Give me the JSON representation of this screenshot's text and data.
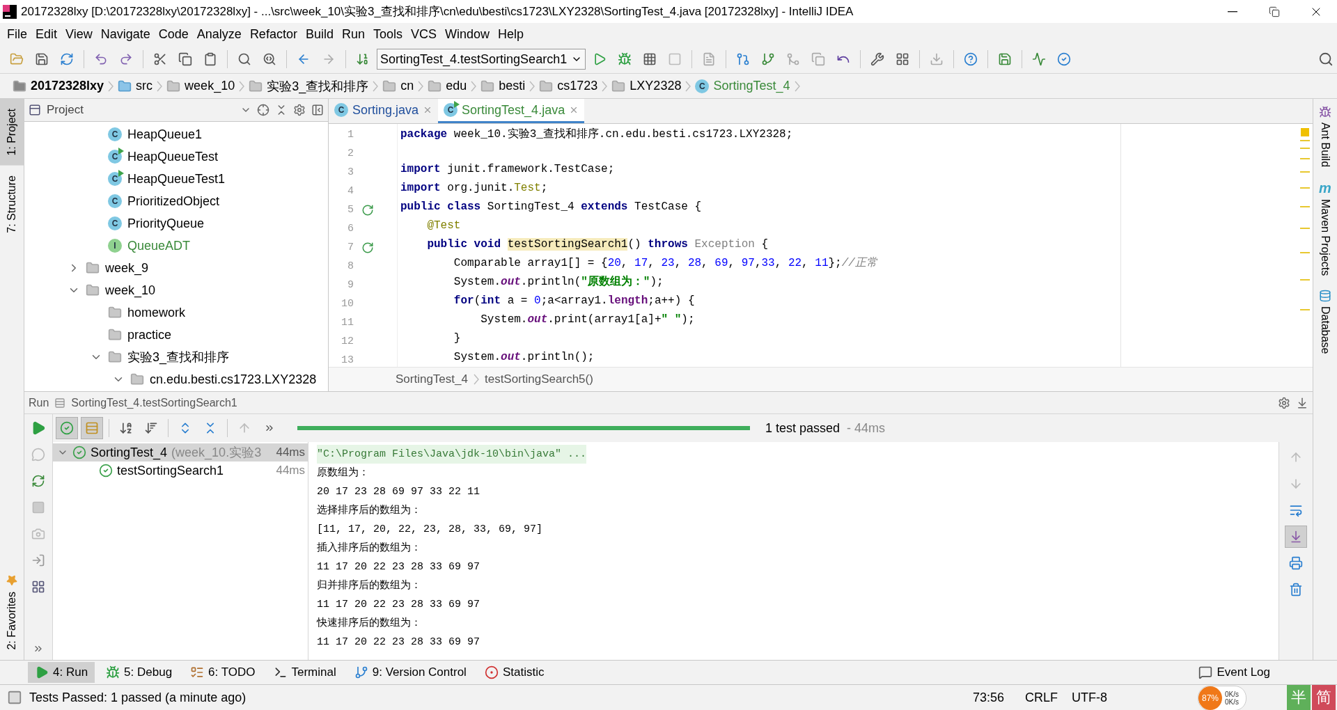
{
  "window": {
    "title": "20172328lxy [D:\\20172328lxy\\20172328lxy] - ...\\src\\week_10\\实验3_查找和排序\\cn\\edu\\besti\\cs1723\\LXY2328\\SortingTest_4.java [20172328lxy] - IntelliJ IDEA"
  },
  "menu": [
    "File",
    "Edit",
    "View",
    "Navigate",
    "Code",
    "Analyze",
    "Refactor",
    "Build",
    "Run",
    "Tools",
    "VCS",
    "Window",
    "Help"
  ],
  "toolbar": {
    "run_configuration": "SortingTest_4.testSortingSearch1"
  },
  "navigation": [
    {
      "label": "20172328lxy",
      "kind": "module"
    },
    {
      "label": "src",
      "kind": "source"
    },
    {
      "label": "week_10",
      "kind": "folder"
    },
    {
      "label": "实验3_查找和排序",
      "kind": "folder"
    },
    {
      "label": "cn",
      "kind": "folder"
    },
    {
      "label": "edu",
      "kind": "folder"
    },
    {
      "label": "besti",
      "kind": "folder"
    },
    {
      "label": "cs1723",
      "kind": "folder"
    },
    {
      "label": "LXY2328",
      "kind": "folder"
    },
    {
      "label": "SortingTest_4",
      "kind": "class",
      "badge": "C",
      "color": "#3a8a3a"
    }
  ],
  "tool_strip_left": [
    {
      "label": "1: Project",
      "selected": true
    },
    {
      "label": "7: Structure",
      "selected": false
    }
  ],
  "favorites": {
    "label": "2: Favorites"
  },
  "tool_strip_right": [
    {
      "label": "Ant Build",
      "kind": "ant"
    },
    {
      "label": "Maven Projects",
      "kind": "maven",
      "glyph": "m"
    },
    {
      "label": "Database",
      "kind": "database"
    }
  ],
  "project": {
    "title": "Project",
    "tree_tail": [
      {
        "label": "HeapQueue1",
        "kind": "class",
        "badge": "C",
        "color": "#000000"
      },
      {
        "label": "HeapQueueTest",
        "kind": "test",
        "badge": "C",
        "color": "#000000"
      },
      {
        "label": "HeapQueueTest1",
        "kind": "test",
        "badge": "C",
        "color": "#000000"
      },
      {
        "label": "PrioritizedObject",
        "kind": "class",
        "badge": "C",
        "color": "#000000"
      },
      {
        "label": "PriorityQueue",
        "kind": "class",
        "badge": "C",
        "color": "#000000"
      },
      {
        "label": "QueueADT",
        "kind": "interface",
        "badge": "I",
        "color": "#3a8a3a"
      }
    ],
    "tree": [
      {
        "label": "week_9",
        "expanded": false
      },
      {
        "label": "week_10",
        "expanded": true,
        "children": [
          {
            "label": "homework"
          },
          {
            "label": "practice"
          },
          {
            "label": "实验3_查找和排序",
            "expanded": true,
            "children": [
              {
                "label": "cn.edu.besti.cs1723.LXY2328",
                "expanded": true
              }
            ]
          }
        ]
      }
    ]
  },
  "editor": {
    "tabs": [
      {
        "label": "Sorting.java",
        "badge": "C",
        "kind": "class",
        "selected": false,
        "color": "#1f4e9c"
      },
      {
        "label": "SortingTest_4.java",
        "badge": "C",
        "kind": "test",
        "selected": true,
        "color": "#3a8a3a"
      }
    ],
    "lines": [
      {
        "number": "1",
        "run": false,
        "tokens": [
          {
            "text": "package",
            "kind": "keyword"
          },
          {
            "text": " week_10.实验3_查找和排序.cn.edu.besti.cs1723.LXY2328;",
            "kind": "plain"
          }
        ]
      },
      {
        "number": "2",
        "run": false
      },
      {
        "number": "3",
        "run": false,
        "tokens": [
          {
            "text": "import",
            "kind": "keyword"
          },
          {
            "text": " junit.framework.TestCase;",
            "kind": "plain"
          }
        ]
      },
      {
        "number": "4",
        "run": false,
        "tokens": [
          {
            "text": "import",
            "kind": "keyword"
          },
          {
            "text": " org.junit.",
            "kind": "plain"
          },
          {
            "text": "Test",
            "kind": "annotation"
          },
          {
            "text": ";",
            "kind": "plain"
          }
        ]
      },
      {
        "number": "5",
        "run": true,
        "tokens": [
          {
            "text": "public class",
            "kind": "keyword"
          },
          {
            "text": " SortingTest_4 ",
            "kind": "plain"
          },
          {
            "text": "extends",
            "kind": "keyword"
          },
          {
            "text": " TestCase {",
            "kind": "plain"
          }
        ]
      },
      {
        "number": "6",
        "run": false,
        "tokens": [
          {
            "text": "    @Test",
            "kind": "annotation"
          }
        ]
      },
      {
        "number": "7",
        "run": true,
        "tokens": [
          {
            "text": "    public void ",
            "kind": "keyword"
          },
          {
            "text": "testSortingSearch1",
            "kind": "highlight"
          },
          {
            "text": "() ",
            "kind": "plain"
          },
          {
            "text": "throws ",
            "kind": "keyword"
          },
          {
            "text": "Exception",
            "kind": "unresolved"
          },
          {
            "text": " {",
            "kind": "plain"
          }
        ]
      },
      {
        "number": "8",
        "run": false,
        "tokens": [
          {
            "text": "        Comparable array1[] = {",
            "kind": "plain"
          },
          {
            "text": "20",
            "kind": "number"
          },
          {
            "text": ", ",
            "kind": "plain"
          },
          {
            "text": "17",
            "kind": "number"
          },
          {
            "text": ", ",
            "kind": "plain"
          },
          {
            "text": "23",
            "kind": "number"
          },
          {
            "text": ", ",
            "kind": "plain"
          },
          {
            "text": "28",
            "kind": "number"
          },
          {
            "text": ", ",
            "kind": "plain"
          },
          {
            "text": "69",
            "kind": "number"
          },
          {
            "text": ", ",
            "kind": "plain"
          },
          {
            "text": "97",
            "kind": "number"
          },
          {
            "text": ",",
            "kind": "plain"
          },
          {
            "text": "33",
            "kind": "number"
          },
          {
            "text": ", ",
            "kind": "plain"
          },
          {
            "text": "22",
            "kind": "number"
          },
          {
            "text": ", ",
            "kind": "plain"
          },
          {
            "text": "11",
            "kind": "number"
          },
          {
            "text": "};",
            "kind": "plain"
          },
          {
            "text": "//正常",
            "kind": "comment"
          }
        ]
      },
      {
        "number": "9",
        "run": false,
        "tokens": [
          {
            "text": "        System.",
            "kind": "plain"
          },
          {
            "text": "out",
            "kind": "field"
          },
          {
            "text": ".println(",
            "kind": "plain"
          },
          {
            "text": "\"原数组为：\"",
            "kind": "string"
          },
          {
            "text": ");",
            "kind": "plain"
          }
        ]
      },
      {
        "number": "10",
        "run": false,
        "tokens": [
          {
            "text": "        for",
            "kind": "keyword"
          },
          {
            "text": "(",
            "kind": "plain"
          },
          {
            "text": "int",
            "kind": "keyword"
          },
          {
            "text": " a = ",
            "kind": "plain"
          },
          {
            "text": "0",
            "kind": "number"
          },
          {
            "text": ";a<array1.",
            "kind": "plain"
          },
          {
            "text": "length",
            "kind": "member"
          },
          {
            "text": ";a++) {",
            "kind": "plain"
          }
        ]
      },
      {
        "number": "11",
        "run": false,
        "tokens": [
          {
            "text": "            System.",
            "kind": "plain"
          },
          {
            "text": "out",
            "kind": "field"
          },
          {
            "text": ".print(array1[a]+",
            "kind": "plain"
          },
          {
            "text": "\" \"",
            "kind": "string"
          },
          {
            "text": ");",
            "kind": "plain"
          }
        ]
      },
      {
        "number": "12",
        "run": false,
        "tokens": [
          {
            "text": "        }",
            "kind": "plain"
          }
        ]
      },
      {
        "number": "13",
        "run": false,
        "tokens": [
          {
            "text": "        System.",
            "kind": "plain"
          },
          {
            "text": "out",
            "kind": "field"
          },
          {
            "text": ".println();",
            "kind": "plain"
          }
        ]
      }
    ],
    "breadcrumb": [
      "SortingTest_4",
      "testSortingSearch5()"
    ]
  },
  "run": {
    "title": "Run",
    "config": "SortingTest_4.testSortingSearch1",
    "progress": {
      "level": 1
    },
    "summary": "1 test passed",
    "duration": "- 44ms",
    "tests": [
      {
        "name": "SortingTest_4",
        "detail": "(week_10.实验3",
        "time": "44ms",
        "passed": true,
        "selected": true,
        "expanded": true,
        "children": [
          {
            "name": "testSortingSearch1",
            "time": "44ms",
            "passed": true,
            "selected": false
          }
        ]
      }
    ],
    "console": [
      {
        "text": "\"C:\\Program Files\\Java\\jdk-10\\bin\\java\" ...",
        "kind": "command"
      },
      {
        "text": "原数组为：",
        "kind": "output"
      },
      {
        "text": "20 17 23 28 69 97 33 22 11",
        "kind": "output"
      },
      {
        "text": "选择排序后的数组为：",
        "kind": "output"
      },
      {
        "text": "[11, 17, 20, 22, 23, 28, 33, 69, 97]",
        "kind": "output"
      },
      {
        "text": "插入排序后的数组为：",
        "kind": "output"
      },
      {
        "text": "11 17 20 22 23 28 33 69 97",
        "kind": "output"
      },
      {
        "text": "归并排序后的数组为：",
        "kind": "output"
      },
      {
        "text": "11 17 20 22 23 28 33 69 97",
        "kind": "output"
      },
      {
        "text": "快速排序后的数组为：",
        "kind": "output"
      },
      {
        "text": "11 17 20 22 23 28 33 69 97",
        "kind": "output"
      }
    ]
  },
  "bottom_tabs": [
    {
      "label": "4: Run",
      "kind": "run",
      "selected": true
    },
    {
      "label": "5: Debug",
      "kind": "debug",
      "selected": false
    },
    {
      "label": "6: TODO",
      "kind": "todo",
      "selected": false
    },
    {
      "label": "Terminal",
      "kind": "terminal",
      "selected": false
    },
    {
      "label": "9: Version Control",
      "kind": "vcs",
      "selected": false
    },
    {
      "label": "Statistic",
      "kind": "statistic",
      "selected": false
    }
  ],
  "event_log": "Event Log",
  "status": {
    "message": "Tests Passed: 1 passed (a minute ago)",
    "position": "73:56",
    "line_separator": "CRLF",
    "encoding": "UTF-8"
  },
  "overlay": {
    "percent": "87%",
    "upload": "0K/s",
    "download": "0K/s",
    "ime": [
      "半",
      "简"
    ]
  }
}
